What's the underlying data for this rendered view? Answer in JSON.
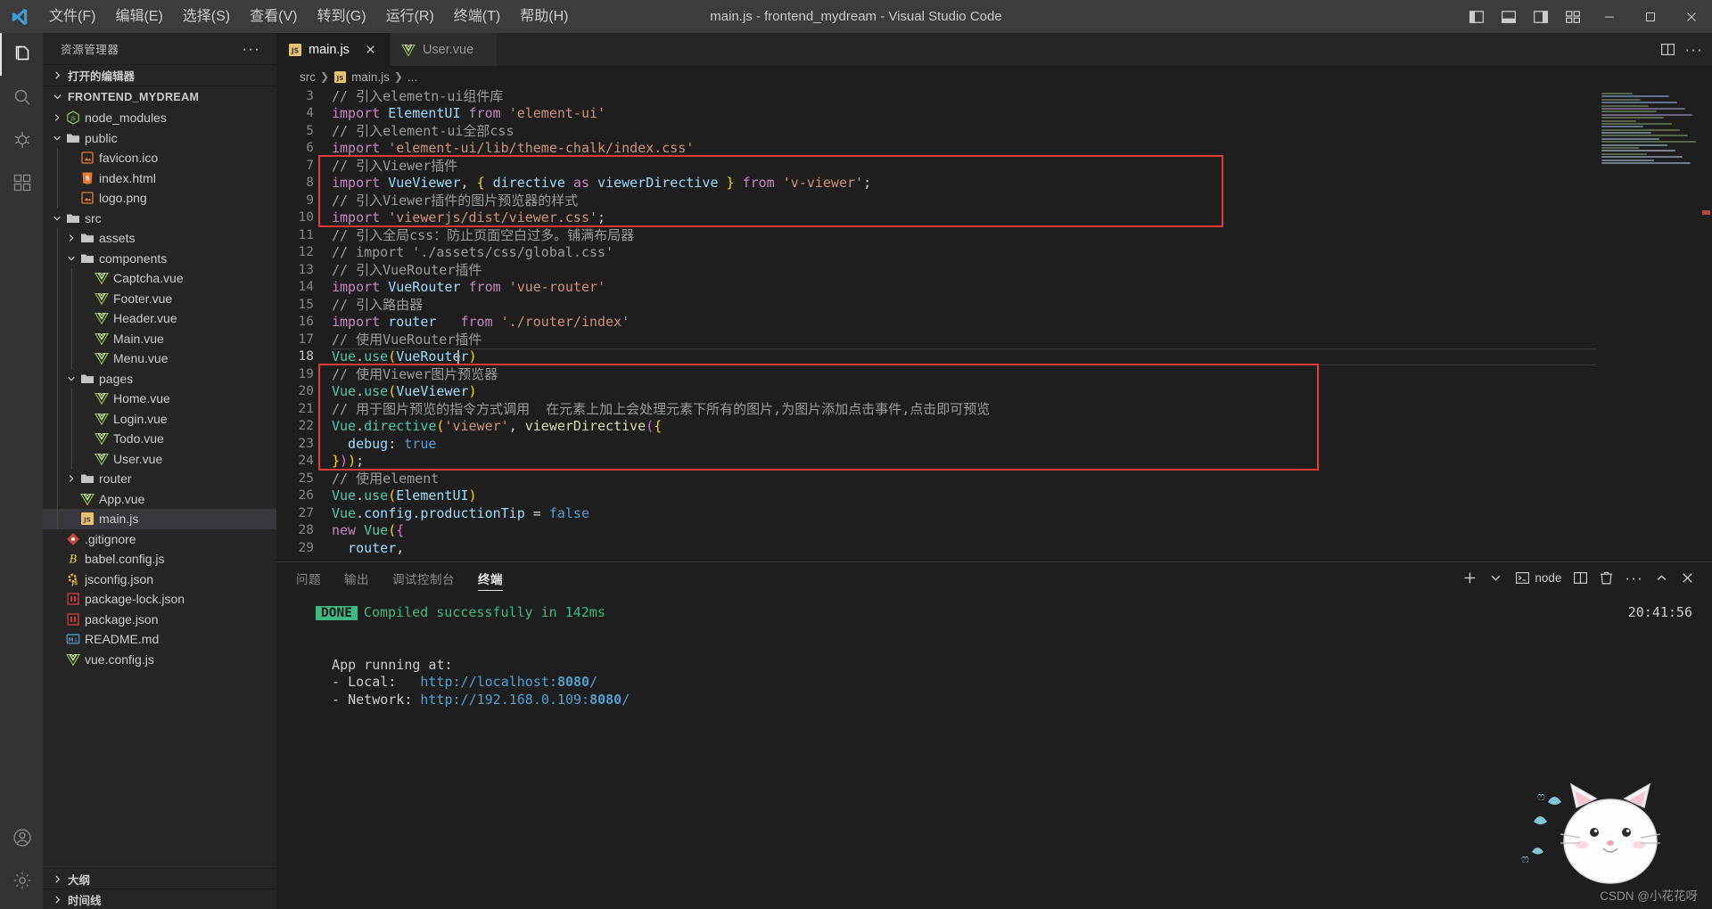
{
  "window": {
    "title": "main.js - frontend_mydream - Visual Studio Code",
    "menu": [
      "文件(F)",
      "编辑(E)",
      "选择(S)",
      "查看(V)",
      "转到(G)",
      "运行(R)",
      "终端(T)",
      "帮助(H)"
    ],
    "controls": {
      "toggle_primary_sidebar": "toggle-primary-sidebar",
      "toggle_panel": "toggle-panel",
      "toggle_secondary_sidebar": "toggle-secondary-sidebar",
      "customize_layout": "customize-layout",
      "minimize": "minimize",
      "maximize": "maximize",
      "close": "close"
    }
  },
  "activitybar": {
    "items": [
      {
        "name": "explorer",
        "icon": "files-icon",
        "active": true
      },
      {
        "name": "search",
        "icon": "search-icon",
        "active": false
      },
      {
        "name": "run-and-debug",
        "icon": "debug-icon",
        "active": false
      },
      {
        "name": "extensions",
        "icon": "extensions-icon",
        "active": false
      }
    ],
    "bottom": [
      {
        "name": "accounts",
        "icon": "account-icon"
      },
      {
        "name": "manage",
        "icon": "gear-icon"
      }
    ]
  },
  "sidebar": {
    "title": "资源管理器",
    "more_actions": "···",
    "open_editors_label": "打开的编辑器",
    "project_root": "FRONTEND_MYDREAM",
    "tree": [
      {
        "label": "node_modules",
        "type": "folder",
        "indent": 1,
        "expanded": false,
        "icon": "nodejs-icon"
      },
      {
        "label": "public",
        "type": "folder",
        "indent": 1,
        "expanded": true,
        "icon": "folder-icon"
      },
      {
        "label": "favicon.ico",
        "type": "file",
        "indent": 2,
        "icon": "image-icon"
      },
      {
        "label": "index.html",
        "type": "file",
        "indent": 2,
        "icon": "html-icon"
      },
      {
        "label": "logo.png",
        "type": "file",
        "indent": 2,
        "icon": "image-icon"
      },
      {
        "label": "src",
        "type": "folder",
        "indent": 1,
        "expanded": true,
        "icon": "folder-icon"
      },
      {
        "label": "assets",
        "type": "folder",
        "indent": 2,
        "expanded": false,
        "icon": "folder-icon"
      },
      {
        "label": "components",
        "type": "folder",
        "indent": 2,
        "expanded": true,
        "icon": "folder-icon"
      },
      {
        "label": "Captcha.vue",
        "type": "file",
        "indent": 3,
        "icon": "vue-icon"
      },
      {
        "label": "Footer.vue",
        "type": "file",
        "indent": 3,
        "icon": "vue-icon"
      },
      {
        "label": "Header.vue",
        "type": "file",
        "indent": 3,
        "icon": "vue-icon"
      },
      {
        "label": "Main.vue",
        "type": "file",
        "indent": 3,
        "icon": "vue-icon"
      },
      {
        "label": "Menu.vue",
        "type": "file",
        "indent": 3,
        "icon": "vue-icon"
      },
      {
        "label": "pages",
        "type": "folder",
        "indent": 2,
        "expanded": true,
        "icon": "folder-icon"
      },
      {
        "label": "Home.vue",
        "type": "file",
        "indent": 3,
        "icon": "vue-icon"
      },
      {
        "label": "Login.vue",
        "type": "file",
        "indent": 3,
        "icon": "vue-icon"
      },
      {
        "label": "Todo.vue",
        "type": "file",
        "indent": 3,
        "icon": "vue-icon"
      },
      {
        "label": "User.vue",
        "type": "file",
        "indent": 3,
        "icon": "vue-icon"
      },
      {
        "label": "router",
        "type": "folder",
        "indent": 2,
        "expanded": false,
        "icon": "folder-icon"
      },
      {
        "label": "App.vue",
        "type": "file",
        "indent": 2,
        "icon": "vue-icon"
      },
      {
        "label": "main.js",
        "type": "file",
        "indent": 2,
        "icon": "js-icon",
        "selected": true
      },
      {
        "label": ".gitignore",
        "type": "file",
        "indent": 1,
        "icon": "git-icon"
      },
      {
        "label": "babel.config.js",
        "type": "file",
        "indent": 1,
        "icon": "babel-icon"
      },
      {
        "label": "jsconfig.json",
        "type": "file",
        "indent": 1,
        "icon": "jsconfig-icon"
      },
      {
        "label": "package-lock.json",
        "type": "file",
        "indent": 1,
        "icon": "npm-icon"
      },
      {
        "label": "package.json",
        "type": "file",
        "indent": 1,
        "icon": "npm-icon"
      },
      {
        "label": "README.md",
        "type": "file",
        "indent": 1,
        "icon": "markdown-icon"
      },
      {
        "label": "vue.config.js",
        "type": "file",
        "indent": 1,
        "icon": "vue-icon"
      }
    ],
    "outline_label": "大纲",
    "timeline_label": "时间线"
  },
  "editor": {
    "tabs": [
      {
        "label": "main.js",
        "icon": "js-icon",
        "active": true,
        "closable": true
      },
      {
        "label": "User.vue",
        "icon": "vue-icon",
        "active": false,
        "closable": false
      }
    ],
    "tab_actions": {
      "split_editor": "split-editor-icon",
      "more": "···"
    },
    "breadcrumb": [
      "src",
      "main.js",
      "..."
    ],
    "first_line_number": 3,
    "cursor_line": 18,
    "lines": [
      {
        "n": 3,
        "tokens": [
          {
            "t": "// 引入elemetn-ui组件库",
            "c": "t-cmt-grey"
          }
        ]
      },
      {
        "n": 4,
        "tokens": [
          {
            "t": "import ",
            "c": "t-kw"
          },
          {
            "t": "ElementUI ",
            "c": "t-var"
          },
          {
            "t": "from ",
            "c": "t-kw"
          },
          {
            "t": "'element-ui'",
            "c": "t-str"
          }
        ]
      },
      {
        "n": 5,
        "tokens": [
          {
            "t": "// 引入element-ui全部css",
            "c": "t-cmt-grey"
          }
        ]
      },
      {
        "n": 6,
        "tokens": [
          {
            "t": "import ",
            "c": "t-kw"
          },
          {
            "t": "'element-ui/lib/theme-chalk/index.css'",
            "c": "t-str"
          }
        ]
      },
      {
        "n": 7,
        "tokens": [
          {
            "t": "// 引入Viewer插件",
            "c": "t-cmt-grey"
          }
        ]
      },
      {
        "n": 8,
        "tokens": [
          {
            "t": "import ",
            "c": "t-kw"
          },
          {
            "t": "VueViewer",
            "c": "t-var"
          },
          {
            "t": ", ",
            "c": "t-plain"
          },
          {
            "t": "{ ",
            "c": "t-br1"
          },
          {
            "t": "directive ",
            "c": "t-var"
          },
          {
            "t": "as ",
            "c": "t-kw"
          },
          {
            "t": "viewerDirective ",
            "c": "t-var"
          },
          {
            "t": "} ",
            "c": "t-br1"
          },
          {
            "t": "from ",
            "c": "t-kw"
          },
          {
            "t": "'v-viewer'",
            "c": "t-str"
          },
          {
            "t": ";",
            "c": "t-plain"
          }
        ]
      },
      {
        "n": 9,
        "tokens": [
          {
            "t": "// 引入Viewer插件的图片预览器的样式",
            "c": "t-cmt-grey"
          }
        ]
      },
      {
        "n": 10,
        "tokens": [
          {
            "t": "import ",
            "c": "t-kw"
          },
          {
            "t": "'viewerjs/dist/viewer.css'",
            "c": "t-str"
          },
          {
            "t": ";",
            "c": "t-plain"
          }
        ]
      },
      {
        "n": 11,
        "tokens": [
          {
            "t": "// 引入全局css：防止页面空白过多。铺满布局器",
            "c": "t-cmt-grey"
          }
        ]
      },
      {
        "n": 12,
        "tokens": [
          {
            "t": "// import './assets/css/global.css'",
            "c": "t-cmt-grey"
          }
        ]
      },
      {
        "n": 13,
        "tokens": [
          {
            "t": "// 引入VueRouter插件",
            "c": "t-cmt-grey"
          }
        ]
      },
      {
        "n": 14,
        "tokens": [
          {
            "t": "import ",
            "c": "t-kw"
          },
          {
            "t": "VueRouter ",
            "c": "t-var"
          },
          {
            "t": "from ",
            "c": "t-kw"
          },
          {
            "t": "'vue-router'",
            "c": "t-str"
          }
        ]
      },
      {
        "n": 15,
        "tokens": [
          {
            "t": "// 引入路由器",
            "c": "t-cmt-grey"
          }
        ]
      },
      {
        "n": 16,
        "tokens": [
          {
            "t": "import ",
            "c": "t-kw"
          },
          {
            "t": "router   ",
            "c": "t-var"
          },
          {
            "t": "from ",
            "c": "t-kw"
          },
          {
            "t": "'./router/index'",
            "c": "t-str"
          }
        ]
      },
      {
        "n": 17,
        "tokens": [
          {
            "t": "// 使用VueRouter插件",
            "c": "t-cmt-grey"
          }
        ]
      },
      {
        "n": 18,
        "tokens": [
          {
            "t": "Vue",
            "c": "t-cls"
          },
          {
            "t": ".",
            "c": "t-plain"
          },
          {
            "t": "use",
            "c": "t-cls"
          },
          {
            "t": "(",
            "c": "t-br1"
          },
          {
            "t": "VueRouter",
            "c": "t-var"
          },
          {
            "t": ")",
            "c": "t-br1"
          }
        ],
        "current": true
      },
      {
        "n": 19,
        "tokens": [
          {
            "t": "// 使用Viewer图片预览器",
            "c": "t-cmt-grey"
          }
        ]
      },
      {
        "n": 20,
        "tokens": [
          {
            "t": "Vue",
            "c": "t-cls"
          },
          {
            "t": ".",
            "c": "t-plain"
          },
          {
            "t": "use",
            "c": "t-cls"
          },
          {
            "t": "(",
            "c": "t-br1"
          },
          {
            "t": "VueViewer",
            "c": "t-var"
          },
          {
            "t": ")",
            "c": "t-br1"
          }
        ]
      },
      {
        "n": 21,
        "tokens": [
          {
            "t": "// 用于图片预览的指令方式调用  在元素上加上会处理元素下所有的图片,为图片添加点击事件,点击即可预览",
            "c": "t-cmt-grey"
          }
        ]
      },
      {
        "n": 22,
        "tokens": [
          {
            "t": "Vue",
            "c": "t-cls"
          },
          {
            "t": ".",
            "c": "t-plain"
          },
          {
            "t": "directive",
            "c": "t-cls"
          },
          {
            "t": "(",
            "c": "t-br1"
          },
          {
            "t": "'viewer'",
            "c": "t-str"
          },
          {
            "t": ", ",
            "c": "t-plain"
          },
          {
            "t": "viewerDirective",
            "c": "t-fn"
          },
          {
            "t": "(",
            "c": "t-br2"
          },
          {
            "t": "{",
            "c": "t-br1"
          }
        ]
      },
      {
        "n": 23,
        "tokens": [
          {
            "t": "  debug",
            "c": "t-var"
          },
          {
            "t": ": ",
            "c": "t-plain"
          },
          {
            "t": "true",
            "c": "t-num"
          }
        ]
      },
      {
        "n": 24,
        "tokens": [
          {
            "t": "}",
            "c": "t-br1"
          },
          {
            "t": ")",
            "c": "t-br2"
          },
          {
            "t": ")",
            "c": "t-br1"
          },
          {
            "t": ";",
            "c": "t-plain"
          }
        ]
      },
      {
        "n": 25,
        "tokens": [
          {
            "t": "// 使用element",
            "c": "t-cmt-grey"
          }
        ]
      },
      {
        "n": 26,
        "tokens": [
          {
            "t": "Vue",
            "c": "t-cls"
          },
          {
            "t": ".",
            "c": "t-plain"
          },
          {
            "t": "use",
            "c": "t-cls"
          },
          {
            "t": "(",
            "c": "t-br1"
          },
          {
            "t": "ElementUI",
            "c": "t-var"
          },
          {
            "t": ")",
            "c": "t-br1"
          }
        ]
      },
      {
        "n": 27,
        "tokens": [
          {
            "t": "Vue",
            "c": "t-cls"
          },
          {
            "t": ".",
            "c": "t-plain"
          },
          {
            "t": "config",
            "c": "t-var"
          },
          {
            "t": ".",
            "c": "t-plain"
          },
          {
            "t": "productionTip ",
            "c": "t-var"
          },
          {
            "t": "= ",
            "c": "t-plain"
          },
          {
            "t": "false",
            "c": "t-num"
          }
        ]
      },
      {
        "n": 28,
        "tokens": [
          {
            "t": "new ",
            "c": "t-kw"
          },
          {
            "t": "Vue",
            "c": "t-cls"
          },
          {
            "t": "(",
            "c": "t-br1"
          },
          {
            "t": "{",
            "c": "t-br2"
          }
        ]
      },
      {
        "n": 29,
        "tokens": [
          {
            "t": "  router",
            "c": "t-var"
          },
          {
            "t": ",",
            "c": "t-plain"
          }
        ]
      }
    ],
    "annotations": [
      {
        "name": "redbox-imports",
        "from_line": 7,
        "to_line": 10
      },
      {
        "name": "redbox-viewer-usage",
        "from_line": 19,
        "to_line": 24
      }
    ]
  },
  "panel": {
    "tabs": [
      {
        "label": "问题",
        "active": false
      },
      {
        "label": "输出",
        "active": false
      },
      {
        "label": "调试控制台",
        "active": false
      },
      {
        "label": "终端",
        "active": true
      }
    ],
    "actions": {
      "new_terminal": "add-icon",
      "new_terminal_dropdown": "chevron-down-icon",
      "terminal_kind": "node",
      "split_terminal": "split-icon",
      "kill_terminal": "trash-icon",
      "more": "···",
      "maximize_panel": "chevron-up-icon",
      "close_panel": "close-icon"
    },
    "terminal": {
      "timestamp": "20:41:56",
      "lines": [
        {
          "type": "status",
          "badge": "DONE",
          "text": "Compiled successfully in 142ms"
        },
        {
          "type": "blank",
          "text": ""
        },
        {
          "type": "blank",
          "text": ""
        },
        {
          "type": "plain",
          "text": "  App running at:"
        },
        {
          "type": "link",
          "prefix": "  - Local:   ",
          "url": "http://localhost:",
          "port": "8080",
          "suffix": "/"
        },
        {
          "type": "link",
          "prefix": "  - Network: ",
          "url": "http://192.168.0.109:",
          "port": "8080",
          "suffix": "/"
        }
      ]
    }
  },
  "watermark": "CSDN @小花花呀",
  "colors": {
    "accent": "#e53935",
    "titlebar_bg": "#3c3c3c",
    "sidebar_bg": "#252526",
    "editor_bg": "#1e1e1e",
    "activitybar_bg": "#333333",
    "selection_bg": "#37373d",
    "vue_green": "#41b883",
    "terminal_link": "#51a0cf"
  }
}
